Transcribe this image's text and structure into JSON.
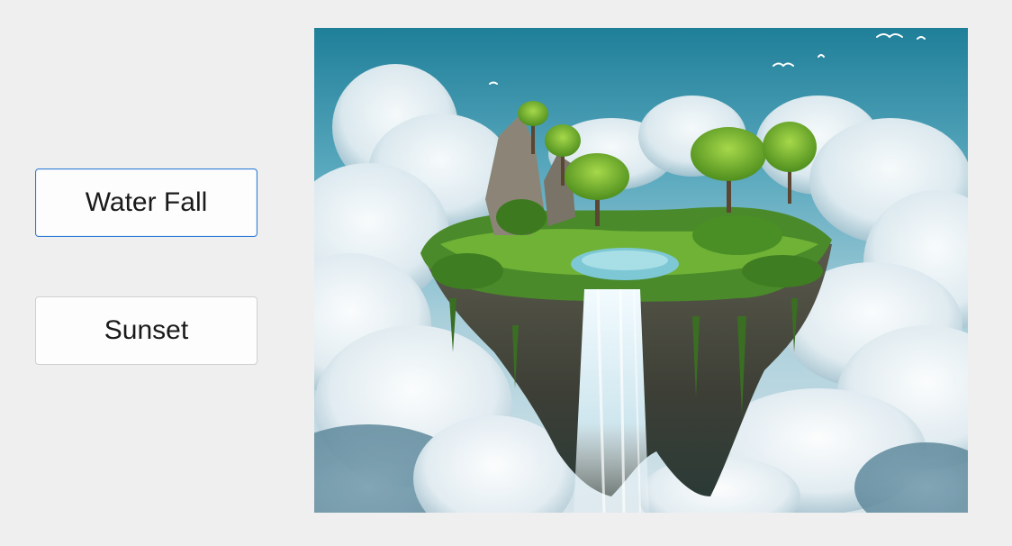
{
  "buttons": {
    "waterfall_label": "Water Fall",
    "sunset_label": "Sunset"
  },
  "picture": {
    "subject": "floating island with waterfall above clouds"
  },
  "colors": {
    "window_background": "#efefef",
    "focus_border": "#2f7bd4",
    "button_border": "#d0d0d0"
  }
}
